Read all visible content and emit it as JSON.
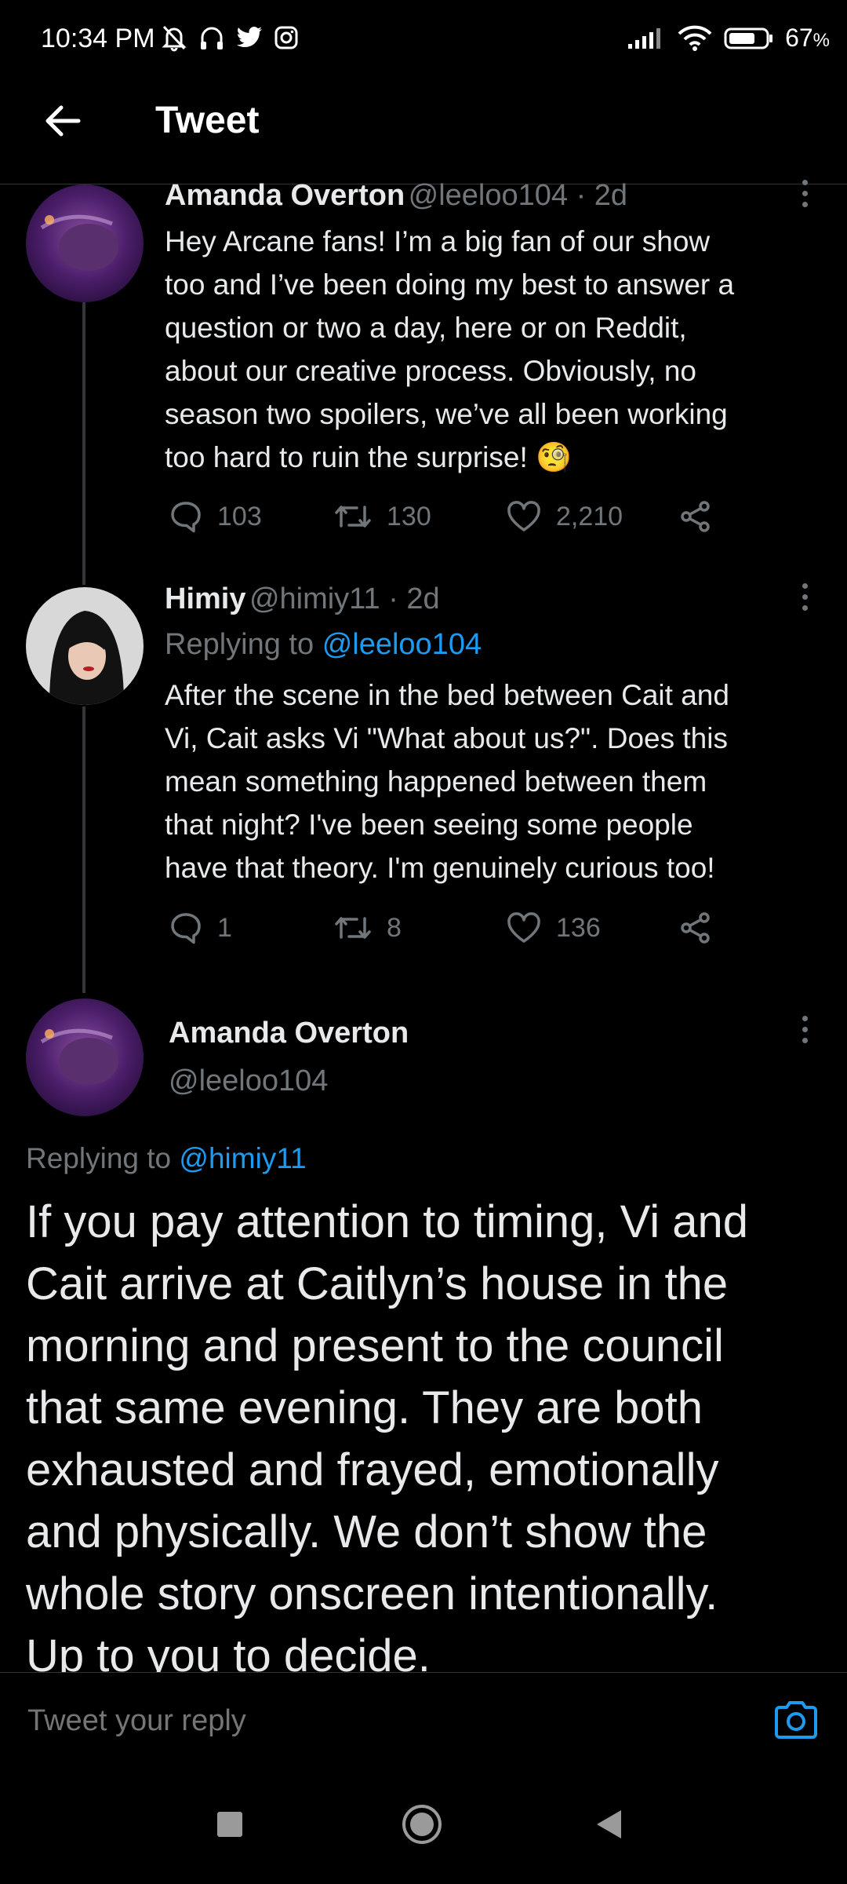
{
  "status_bar": {
    "time": "10:34 PM",
    "battery": "67",
    "battery_unit": "%"
  },
  "header": {
    "title": "Tweet"
  },
  "tweets": [
    {
      "name": "Amanda Overton",
      "handle_time": "@leeloo104 · 2d",
      "lines": [
        "Hey Arcane fans! I’m a big fan of our show",
        "too and I’ve been doing my best to answer a",
        "question or two a day, here or on Reddit,",
        "about our creative process. Obviously, no",
        "season two spoilers, we’ve all been working",
        "too hard to ruin the surprise! 🧐"
      ],
      "replies": "103",
      "retweets": "130",
      "likes": "2,210"
    },
    {
      "name": "Himiy",
      "handle_time": "@himiy11 · 2d",
      "replying_prefix": "Replying to",
      "replying_to": "@leeloo104",
      "lines": [
        "After the scene in the bed between Cait and",
        "Vi, Cait asks Vi \"What about us?\". Does this",
        "mean something happened between them",
        "that night? I've been seeing some people",
        "have that theory. I'm genuinely curious too!"
      ],
      "replies": "1",
      "retweets": "8",
      "likes": "136"
    }
  ],
  "main_tweet": {
    "name": "Amanda Overton",
    "handle": "@leeloo104",
    "replying_prefix": "Replying to",
    "replying_to": "@himiy11",
    "lines": [
      "If you pay attention to timing, Vi and",
      "Cait arrive at Caitlyn’s house in the",
      "morning and present to the council",
      "that same evening. They are both",
      "exhausted and frayed, emotionally",
      "and physically. We don’t show the",
      "whole story onscreen intentionally.",
      "Up to you to decide."
    ]
  },
  "reply_bar": {
    "placeholder": "Tweet your reply"
  },
  "colors": {
    "background": "#000000",
    "accent": "#1d9bf0",
    "muted": "#71767b"
  }
}
